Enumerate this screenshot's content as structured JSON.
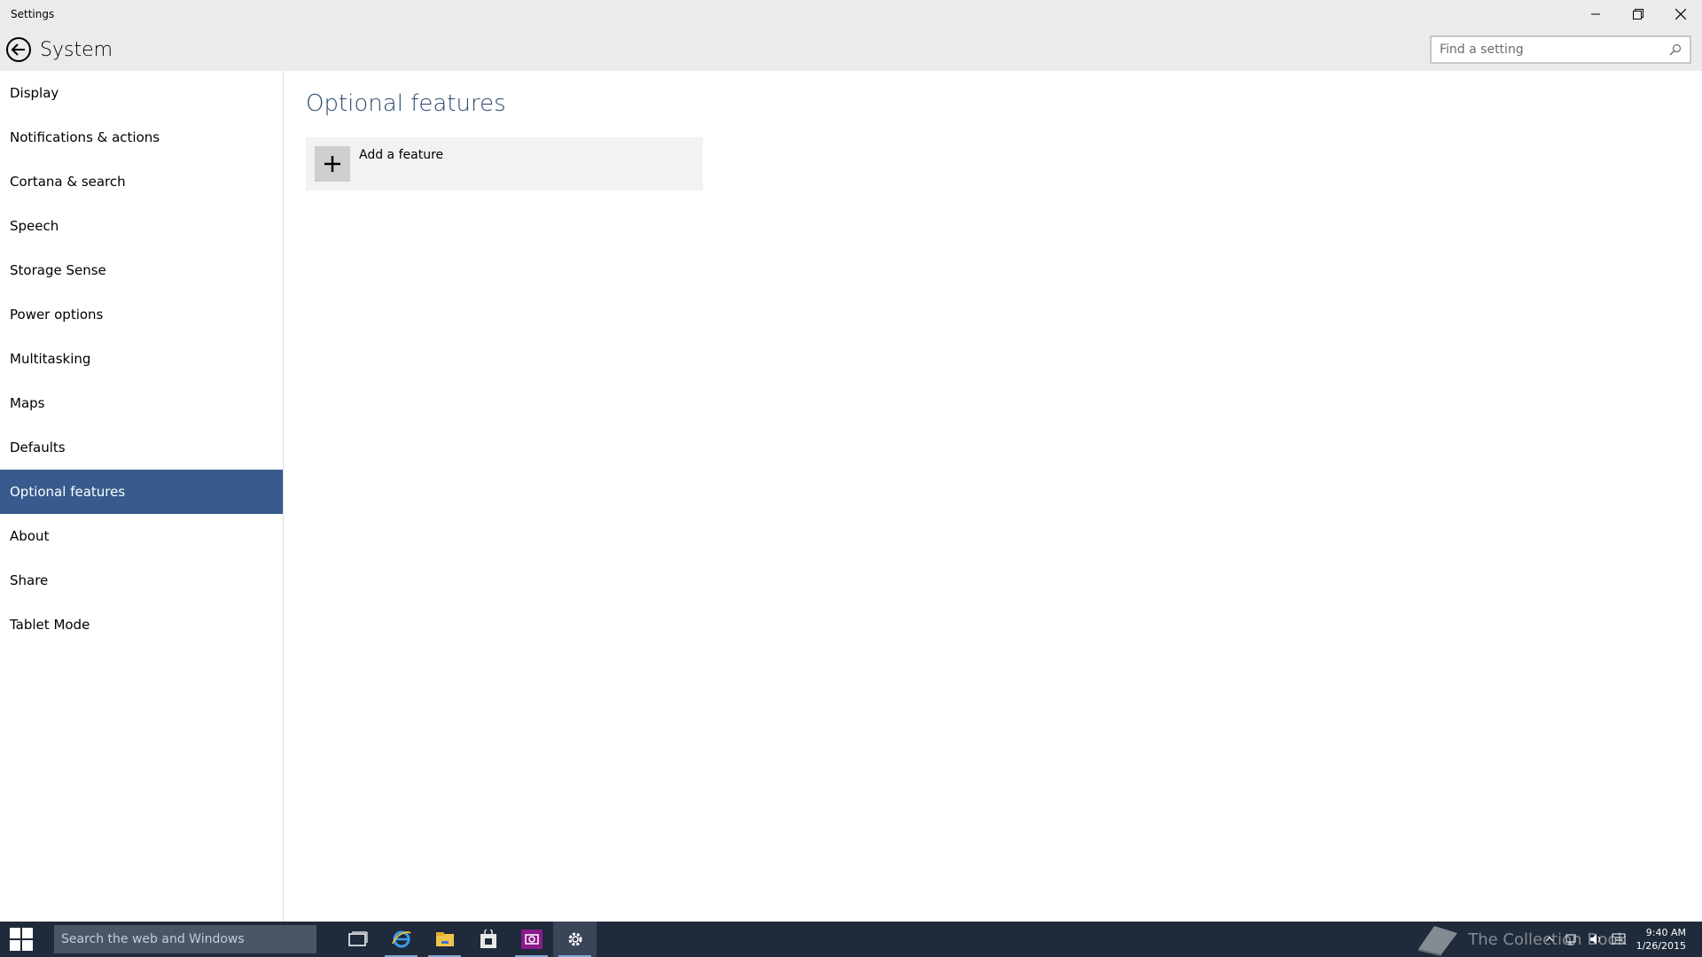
{
  "window": {
    "title": "Settings"
  },
  "header": {
    "title": "System",
    "search_placeholder": "Find a setting"
  },
  "sidebar": {
    "items": [
      {
        "label": "Display"
      },
      {
        "label": "Notifications & actions"
      },
      {
        "label": "Cortana & search"
      },
      {
        "label": "Speech"
      },
      {
        "label": "Storage Sense"
      },
      {
        "label": "Power options"
      },
      {
        "label": "Multitasking"
      },
      {
        "label": "Maps"
      },
      {
        "label": "Defaults"
      },
      {
        "label": "Optional features",
        "selected": true
      },
      {
        "label": "About"
      },
      {
        "label": "Share"
      },
      {
        "label": "Tablet Mode"
      }
    ]
  },
  "main": {
    "title": "Optional features",
    "add_feature_label": "Add a feature"
  },
  "taskbar": {
    "search_placeholder": "Search the web and Windows",
    "pinned": [
      {
        "icon": "task-view-icon"
      },
      {
        "icon": "internet-explorer-icon"
      },
      {
        "icon": "file-explorer-icon"
      },
      {
        "icon": "store-icon"
      },
      {
        "icon": "camera-app-icon"
      },
      {
        "icon": "settings-gear-icon"
      }
    ],
    "watermark": "The Collection Book",
    "clock": {
      "time": "9:40 AM",
      "date": "1/26/2015"
    }
  },
  "colors": {
    "accent": "#365b8c",
    "title_accent": "#2b4a70",
    "taskbar": "#1f2a3a"
  }
}
